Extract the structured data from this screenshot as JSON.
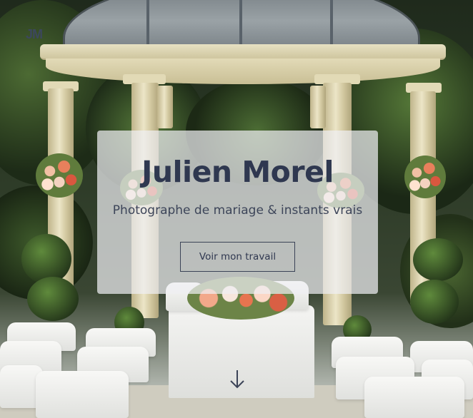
{
  "brand": {
    "logo_text": "JM"
  },
  "hero": {
    "title": "Julien Morel",
    "subtitle": "Photographe de mariage & instants vrais",
    "cta_label": "Voir mon travail"
  },
  "scroll": {
    "icon": "arrow-down-icon"
  },
  "colors": {
    "text_primary": "#2f3850",
    "card_background": "rgba(238,238,242,0.72)",
    "button_border": "#3b4357"
  }
}
